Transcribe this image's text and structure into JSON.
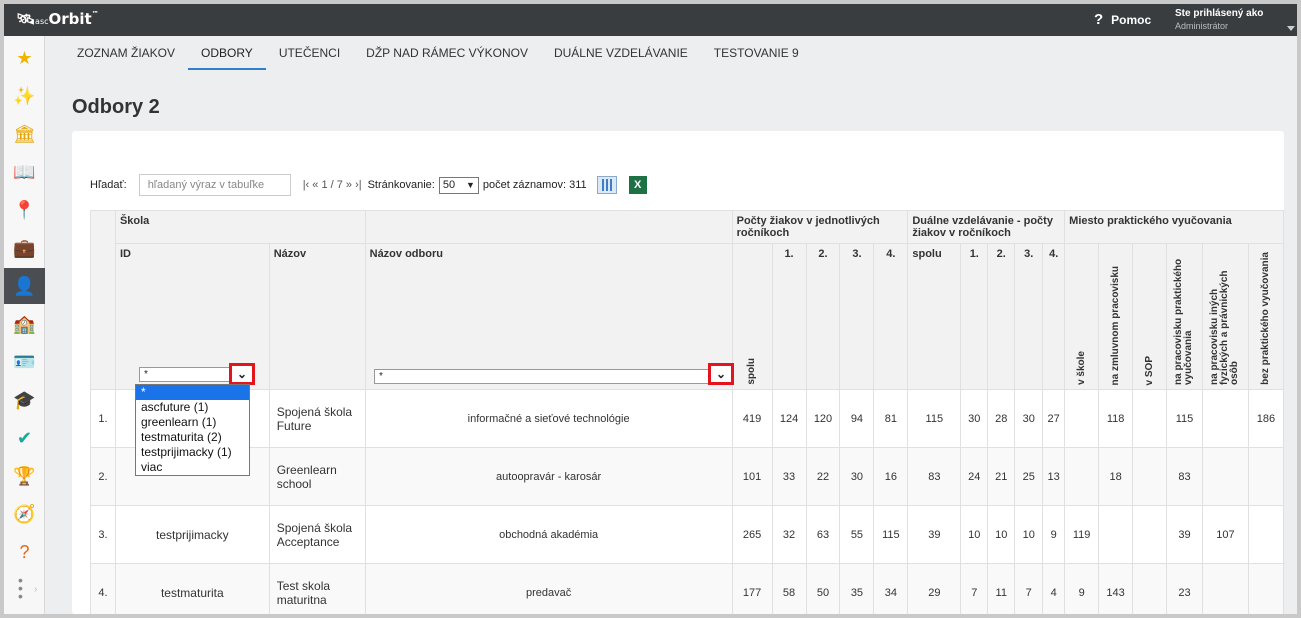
{
  "app": {
    "logo_prefix": "asc",
    "logo_name": "Orbit",
    "logo_tm": "™"
  },
  "header": {
    "help_icon": "?",
    "help_label": "Pomoc",
    "user_line": "Ste prihlásený ako",
    "user_role": "Administrátor"
  },
  "sidebar": {
    "icons": [
      {
        "name": "star-icon",
        "glyph": "★",
        "color": "#f0b400"
      },
      {
        "name": "magic-wand-icon",
        "glyph": "✨",
        "color": "#e0402a"
      },
      {
        "name": "bank-icon",
        "glyph": "🏛",
        "color": "#e3a300"
      },
      {
        "name": "book-icon",
        "glyph": "📖",
        "color": "#2a7fc4"
      },
      {
        "name": "location-pin-icon",
        "glyph": "📍",
        "color": "#2aa84a"
      },
      {
        "name": "briefcase-icon",
        "glyph": "💼",
        "color": "#2a7fc4"
      },
      {
        "name": "student-icon",
        "glyph": "👤",
        "color": "#ffffff"
      },
      {
        "name": "school-add-icon",
        "glyph": "🏫",
        "color": "#e06a1a"
      },
      {
        "name": "id-badge-icon",
        "glyph": "🪪",
        "color": "#2aa84a"
      },
      {
        "name": "graduation-cap-icon",
        "glyph": "🎓",
        "color": "#e0402a"
      },
      {
        "name": "check-circle-icon",
        "glyph": "✔",
        "color": "#1aa89a"
      },
      {
        "name": "trophy-icon",
        "glyph": "🏆",
        "color": "#8a2a8a"
      },
      {
        "name": "compass-icon",
        "glyph": "🧭",
        "color": "#2aa84a"
      },
      {
        "name": "help-book-icon",
        "glyph": "?",
        "color": "#e06a1a"
      }
    ]
  },
  "tabs": [
    {
      "label": "ZOZNAM ŽIAKOV",
      "active": false
    },
    {
      "label": "ODBORY",
      "active": true
    },
    {
      "label": "UTEČENCI",
      "active": false
    },
    {
      "label": "DŽP NAD RÁMEC VÝKONOV",
      "active": false
    },
    {
      "label": "DUÁLNE VZDELÁVANIE",
      "active": false
    },
    {
      "label": "TESTOVANIE 9",
      "active": false
    }
  ],
  "page": {
    "title": "Odbory 2"
  },
  "toolbar": {
    "search_label": "Hľadať:",
    "search_placeholder": "hľadaný výraz v tabuľke",
    "pager": "|‹ « 1 / 7 » ›|",
    "paging_label": "Stránkovanie:",
    "page_size": "50",
    "record_count": "počet záznamov: 311"
  },
  "table": {
    "group_headers": {
      "skola": "Škola",
      "pocty": "Počty žiakov v jednotlivých ročníkoch",
      "dualne": "Duálne vzdelávanie - počty žiakov v ročníkoch",
      "miesto": "Miesto praktického vyučovania"
    },
    "headers": {
      "id": "ID",
      "nazov": "Názov",
      "odbor": "Názov odboru",
      "spolu": "spolu",
      "r1": "1.",
      "r2": "2.",
      "r3": "3.",
      "r4": "4.",
      "d_spolu": "spolu",
      "d1": "1.",
      "d2": "2.",
      "d3": "3.",
      "d4": "4.",
      "m_skole": "v škole",
      "m_zmluvnom": "na zmluvnom pracovisku",
      "m_sop": "v SOP",
      "m_pracovisku": "na pracovisku praktického vyučovania",
      "m_inych": "na pracovisku iných fyzických a právnických osôb",
      "m_bez": "bez praktického vyučovania"
    },
    "filters": {
      "id_value": "*",
      "odbor_value": "*"
    },
    "rows": [
      {
        "idx": "1.",
        "id": "",
        "nazov": "Spojená škola Future",
        "odbor": "informačné a sieťové technológie",
        "spolu": "419",
        "r1": "124",
        "r2": "120",
        "r3": "94",
        "r4": "81",
        "ds": "115",
        "d1": "30",
        "d2": "28",
        "d3": "30",
        "d4": "27",
        "ms": "",
        "mz": "118",
        "sop": "",
        "mp": "115",
        "mi": "",
        "mb": "186"
      },
      {
        "idx": "2.",
        "id": "",
        "nazov": "Greenlearn school",
        "odbor": "autoopravár - karosár",
        "spolu": "101",
        "r1": "33",
        "r2": "22",
        "r3": "30",
        "r4": "16",
        "ds": "83",
        "d1": "24",
        "d2": "21",
        "d3": "25",
        "d4": "13",
        "ms": "",
        "mz": "18",
        "sop": "",
        "mp": "83",
        "mi": "",
        "mb": ""
      },
      {
        "idx": "3.",
        "id": "testprijimacky",
        "nazov": "Spojená škola Acceptance",
        "odbor": "obchodná akadémia",
        "spolu": "265",
        "r1": "32",
        "r2": "63",
        "r3": "55",
        "r4": "115",
        "ds": "39",
        "d1": "10",
        "d2": "10",
        "d3": "10",
        "d4": "9",
        "ms": "119",
        "mz": "",
        "sop": "",
        "mp": "39",
        "mi": "107",
        "mb": ""
      },
      {
        "idx": "4.",
        "id": "testmaturita",
        "nazov": "Test skola maturitna",
        "odbor": "predavač",
        "spolu": "177",
        "r1": "58",
        "r2": "50",
        "r3": "35",
        "r4": "34",
        "ds": "29",
        "d1": "7",
        "d2": "11",
        "d3": "7",
        "d4": "4",
        "ms": "9",
        "mz": "143",
        "sop": "",
        "mp": "23",
        "mi": "",
        "mb": ""
      }
    ]
  },
  "id_dropdown": {
    "options": [
      "*",
      "ascfuture (1)",
      "greenlearn (1)",
      "testmaturita (2)",
      "testprijimacky (1)",
      "viac"
    ],
    "selected": "*"
  },
  "colors": {
    "topbar": "#3a3d40",
    "accent": "#2f7fcc",
    "highlight": "#e4141d",
    "excel": "#1e7145"
  }
}
